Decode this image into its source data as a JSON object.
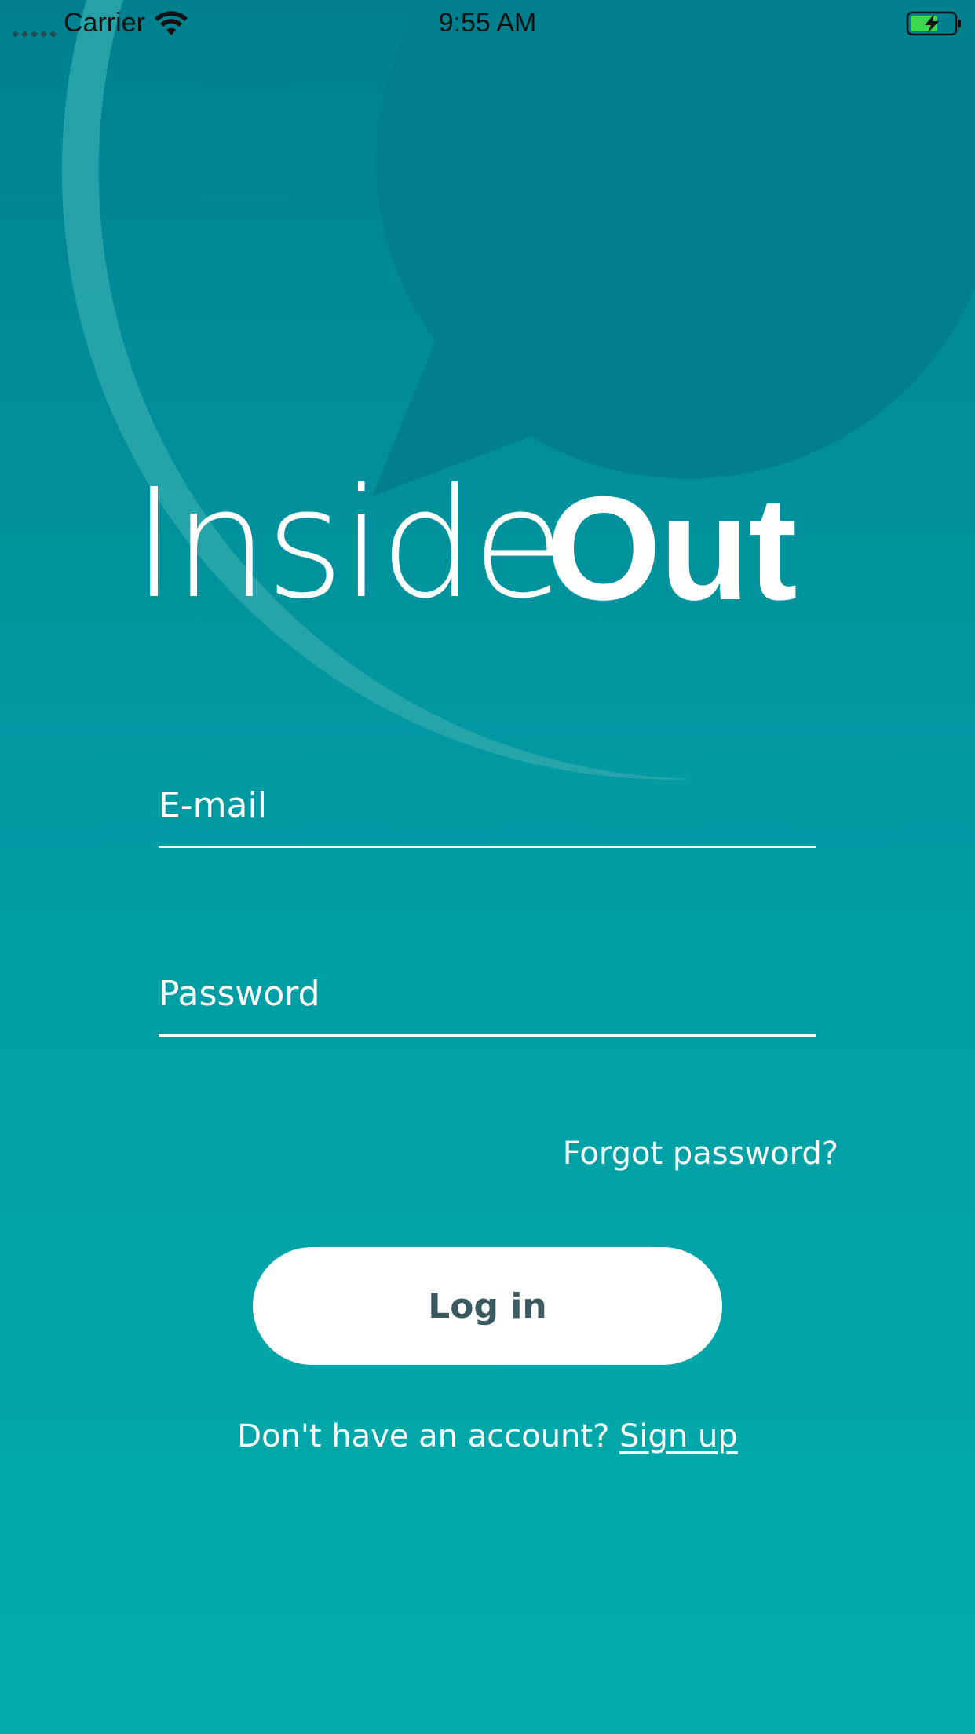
{
  "status_bar": {
    "carrier": "Carrier",
    "time": "9:55 AM",
    "wifi_icon": "wifi-icon",
    "battery_icon": "battery-charging-icon"
  },
  "logo": {
    "light_text": "Inside",
    "bold_text": "Out"
  },
  "form": {
    "email_placeholder": "E-mail",
    "password_placeholder": "Password",
    "forgot_label": "Forgot password?",
    "login_label": "Log in"
  },
  "signup": {
    "prompt": "Don't have an account?",
    "link_label": "Sign up"
  },
  "colors": {
    "background_top": "#00808f",
    "background_bottom": "#00adac",
    "bubble": "#2ba7ad",
    "button_text": "#3a5a60"
  }
}
